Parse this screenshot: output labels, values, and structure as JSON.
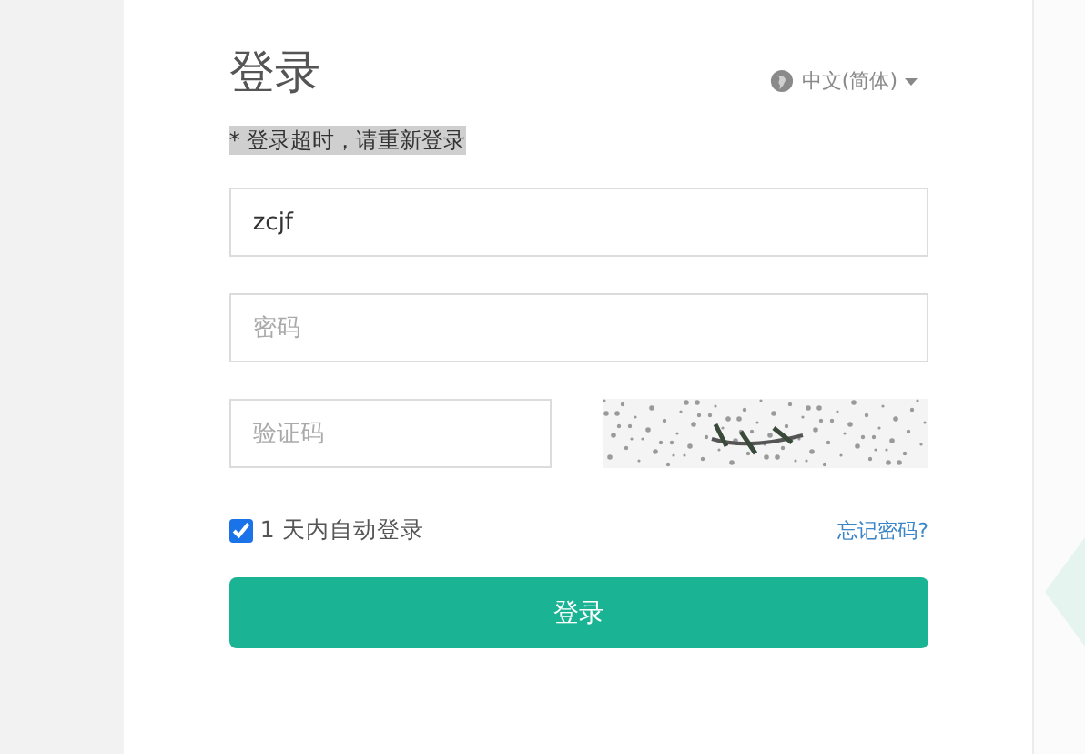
{
  "title": "登录",
  "language": {
    "label": "中文(简体)"
  },
  "alert": "* 登录超时，请重新登录",
  "username": {
    "value": "zcjf"
  },
  "password": {
    "placeholder": "密码"
  },
  "captcha": {
    "placeholder": "验证码"
  },
  "remember": {
    "label": "1 天内自动登录",
    "checked": true
  },
  "forgot_link": "忘记密码?",
  "submit": "登录"
}
